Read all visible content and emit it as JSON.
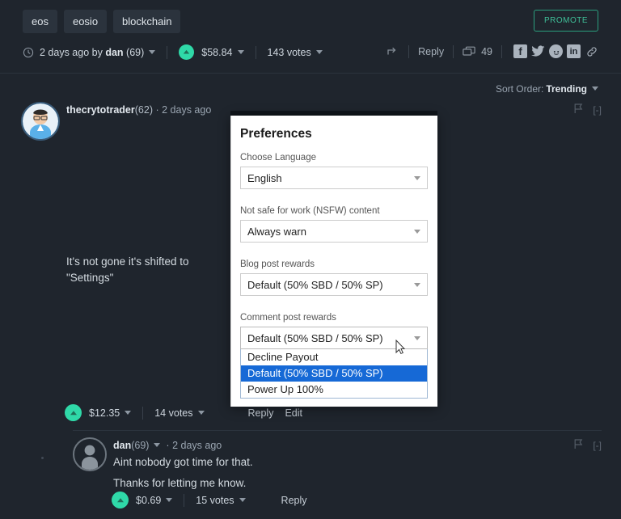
{
  "post": {
    "tags": [
      "eos",
      "eosio",
      "blockchain"
    ],
    "promote_label": "PROMOTE",
    "timestamp": "2 days ago by ",
    "author": "dan",
    "author_reputation": "(69)",
    "payout": "$58.84",
    "votes": "143 votes",
    "reply_label": "Reply",
    "comment_count": "49",
    "icons": {
      "clock": "clock-icon",
      "share": "share-icon",
      "comments": "comments-icon",
      "facebook": "f",
      "twitter": "twitter-icon",
      "reddit": "reddit-icon",
      "linkedin": "in",
      "link": "link-icon"
    }
  },
  "sort": {
    "label": "Sort Order:",
    "value": "Trending"
  },
  "comment1": {
    "author": "thecrytotrader",
    "reputation": "(62)",
    "separator": "·",
    "timestamp": "2 days ago",
    "body": "It's not gone it's shifted to \"Settings\"",
    "payout": "$12.35",
    "votes": "14 votes",
    "reply_label": "Reply",
    "edit_label": "Edit",
    "collapse_label": "[-]",
    "flag_icon": "flag-icon"
  },
  "comment2": {
    "author": "dan",
    "reputation": "(69)",
    "separator": "·",
    "timestamp": "2 days ago",
    "line1": "Aint nobody got time for that.",
    "line2": "Thanks for letting me know.",
    "payout": "$0.69",
    "votes": "15 votes",
    "reply_label": "Reply",
    "collapse_label": "[-]",
    "flag_icon": "flag-icon"
  },
  "preferences": {
    "title": "Preferences",
    "language": {
      "label": "Choose Language",
      "value": "English"
    },
    "nsfw": {
      "label": "Not safe for work (NSFW) content",
      "value": "Always warn"
    },
    "blog_rewards": {
      "label": "Blog post rewards",
      "value": "Default (50% SBD / 50% SP)"
    },
    "comment_rewards": {
      "label": "Comment post rewards",
      "value": "Default (50% SBD / 50% SP)",
      "options": [
        "Decline Payout",
        "Default (50% SBD / 50% SP)",
        "Power Up 100%"
      ],
      "selected_index": 1
    }
  },
  "colors": {
    "background": "#1f252d",
    "tag_pill": "#2b333d",
    "accent_green": "#2fd9a8",
    "promote_border": "#2b9e7e",
    "modal_bg": "#ffffff",
    "option_selected": "#1669d6"
  }
}
